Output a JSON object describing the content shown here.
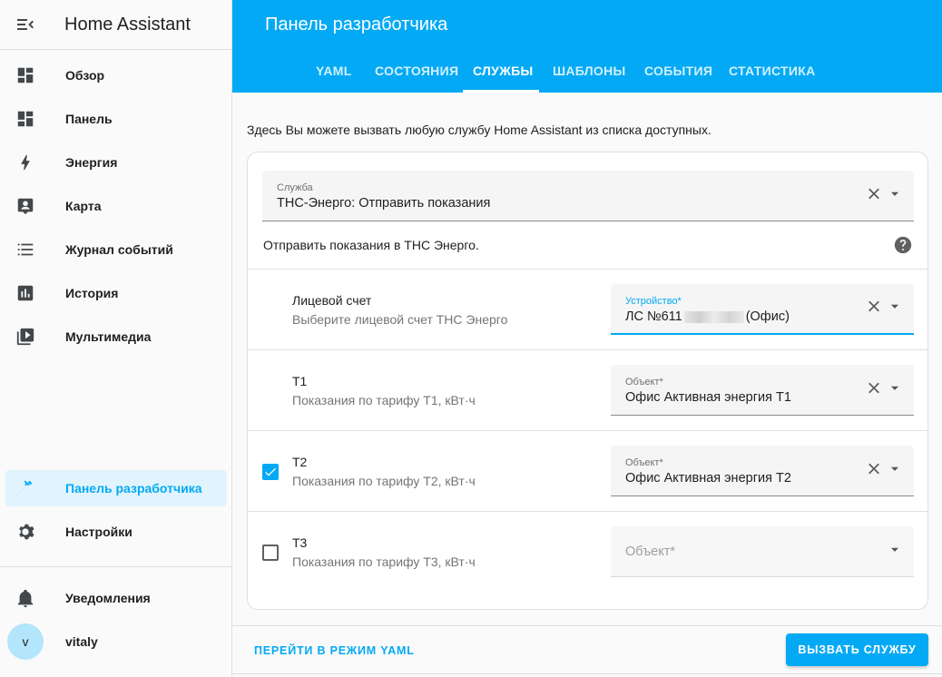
{
  "app": {
    "title": "Home Assistant"
  },
  "sidebar": {
    "items": [
      {
        "label": "Обзор",
        "icon": "dashboard-icon"
      },
      {
        "label": "Панель",
        "icon": "dashboard-icon"
      },
      {
        "label": "Энергия",
        "icon": "lightning-icon"
      },
      {
        "label": "Карта",
        "icon": "map-account-icon"
      },
      {
        "label": "Журнал событий",
        "icon": "logbook-list-icon"
      },
      {
        "label": "История",
        "icon": "history-chart-icon"
      },
      {
        "label": "Мультимедиа",
        "icon": "media-play-icon"
      }
    ],
    "dev_tools": {
      "label": "Панель разработчика",
      "icon": "hammer-icon"
    },
    "settings": {
      "label": "Настройки",
      "icon": "gear-icon"
    },
    "notifications": {
      "label": "Уведомления",
      "icon": "bell-icon"
    },
    "user": {
      "initial": "v",
      "name": "vitaly"
    }
  },
  "header": {
    "title": "Панель разработчика",
    "tabs": [
      {
        "label": "YAML"
      },
      {
        "label": "СОСТОЯНИЯ"
      },
      {
        "label": "СЛУЖБЫ"
      },
      {
        "label": "ШАБЛОНЫ"
      },
      {
        "label": "СОБЫТИЯ"
      },
      {
        "label": "СТАТИСТИКА"
      }
    ],
    "active_tab": "СЛУЖБЫ"
  },
  "main": {
    "intro": "Здесь Вы можете вызвать любую службу Home Assistant из списка доступных.",
    "service_field": {
      "label": "Служба",
      "value": "ТНС-Энерго: Отправить показания"
    },
    "service_description": "Отправить показания в ТНС Энерго.",
    "params": [
      {
        "title": "Лицевой счет",
        "subtitle": "Выберите лицевой счет ТНС Энерго",
        "field_label": "Устройство*",
        "value_prefix": "ЛС №611",
        "value_suffix": "(Офис)"
      },
      {
        "title": "Т1",
        "subtitle": "Показания по тарифу Т1, кВт·ч",
        "field_label": "Объект*",
        "value": "Офис Активная энергия Т1"
      },
      {
        "title": "Т2",
        "subtitle": "Показания по тарифу Т2, кВт·ч",
        "field_label": "Объект*",
        "value": "Офис Активная энергия Т2",
        "checked": true
      },
      {
        "title": "Т3",
        "subtitle": "Показания по тарифу Т3, кВт·ч",
        "placeholder": "Объект*",
        "checked": false
      }
    ]
  },
  "footer": {
    "yaml_mode_label": "ПЕРЕЙТИ В РЕЖИМ YAML",
    "call_service_label": "ВЫЗВАТЬ СЛУЖБУ"
  },
  "colors": {
    "accent": "#03a9f4",
    "active_bg": "#e1f4fd"
  }
}
